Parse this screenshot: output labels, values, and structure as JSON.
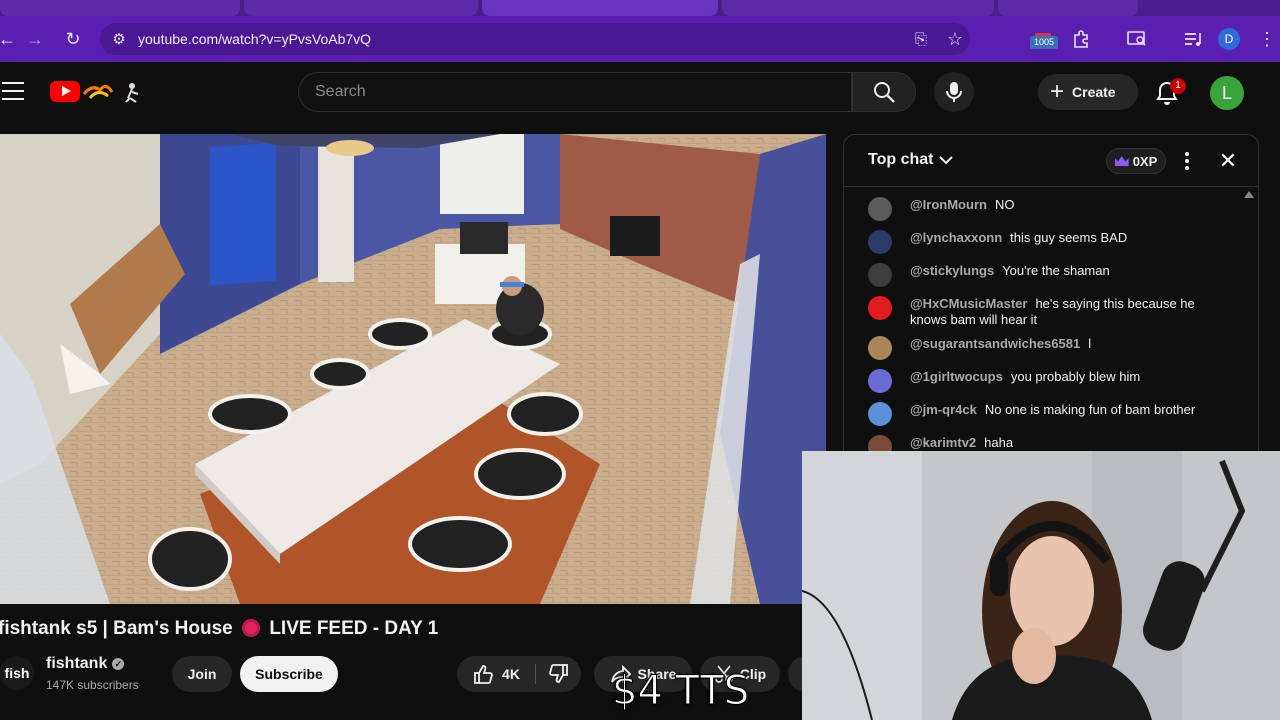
{
  "browser": {
    "url": "youtube.com/watch?v=yPvsVoAb7vQ",
    "extension_badge": "1005",
    "profile_initial": "D"
  },
  "header": {
    "search_placeholder": "Search",
    "create_label": "Create",
    "notification_count": "1",
    "avatar_initial": "L"
  },
  "video": {
    "title_prefix": "fishtank s5 | Bam's House",
    "title_suffix": "LIVE FEED - DAY 1",
    "channel_logo_text": "fish",
    "channel_name": "fishtank",
    "subscribers": "147K subscribers",
    "join_label": "Join",
    "subscribe_label": "Subscribe",
    "like_count": "4K",
    "share_label": "Share",
    "clip_label": "Clip"
  },
  "chat": {
    "mode_label": "Top chat",
    "xp_label": "0XP",
    "messages": [
      {
        "author": "@IronMourn",
        "text": "NO",
        "avatar_color": "#5a5a5a"
      },
      {
        "author": "@lynchaxxonn",
        "text": "this guy seems BAD",
        "avatar_color": "#2c3a66"
      },
      {
        "author": "@stickylungs",
        "text": "You're the shaman",
        "avatar_color": "#3d3d3d"
      },
      {
        "author": "@HxCMusicMaster",
        "text": "he's saying this because he knows bam will hear it",
        "avatar_color": "#e11d1d"
      },
      {
        "author": "@sugarantsandwiches6581",
        "text": "l",
        "avatar_color": "#a8865a"
      },
      {
        "author": "@1girltwocups",
        "text": "you probably blew him",
        "avatar_color": "#6b6bd6"
      },
      {
        "author": "@jm-qr4ck",
        "text": "No one is making fun of bam brother",
        "avatar_color": "#5b8fd6"
      },
      {
        "author": "@karimtv2",
        "text": "haha",
        "avatar_color": "#7a4a3a"
      }
    ]
  },
  "overlay": {
    "tts_text": "$4 TTS"
  },
  "colors": {
    "browser_purple": "#5a1fb0",
    "yt_red": "#ff0000",
    "page_bg": "#0f0f0f"
  }
}
